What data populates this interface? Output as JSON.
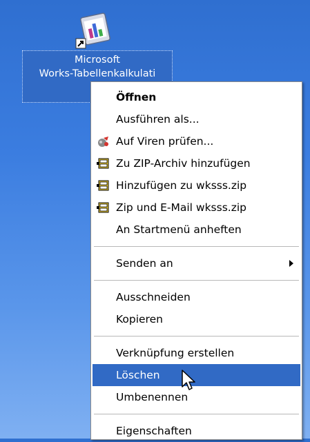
{
  "desktop": {
    "shortcut": {
      "icon": "works-spreadsheet-shortcut-icon",
      "label_line1": "Microsoft",
      "label_line2": "Works-Tabellenkalkulati"
    }
  },
  "context_menu": {
    "items": [
      {
        "label": "Öffnen",
        "icon": null
      },
      {
        "label": "Ausführen als...",
        "icon": null
      },
      {
        "label": "Auf Viren prüfen...",
        "icon": "virus-scan-icon"
      },
      {
        "label": "Zu ZIP-Archiv hinzufügen",
        "icon": "winzip-icon"
      },
      {
        "label": "Hinzufügen zu wksss.zip",
        "icon": "winzip-icon"
      },
      {
        "label": "Zip und E-Mail wksss.zip",
        "icon": "winzip-icon"
      },
      {
        "label": "An Startmenü anheften",
        "icon": null
      },
      {
        "label": "Senden an",
        "icon": null
      },
      {
        "label": "Ausschneiden",
        "icon": null
      },
      {
        "label": "Kopieren",
        "icon": null
      },
      {
        "label": "Verknüpfung erstellen",
        "icon": null
      },
      {
        "label": "Löschen",
        "icon": null
      },
      {
        "label": "Umbenennen",
        "icon": null
      },
      {
        "label": "Eigenschaften",
        "icon": null
      }
    ],
    "highlighted_item": "Löschen",
    "highlight_color": "#316ac5"
  },
  "colors": {
    "desktop_top": "#2f6fd0",
    "desktop_bottom": "#7fb0f2",
    "selection": "#316ac5"
  }
}
